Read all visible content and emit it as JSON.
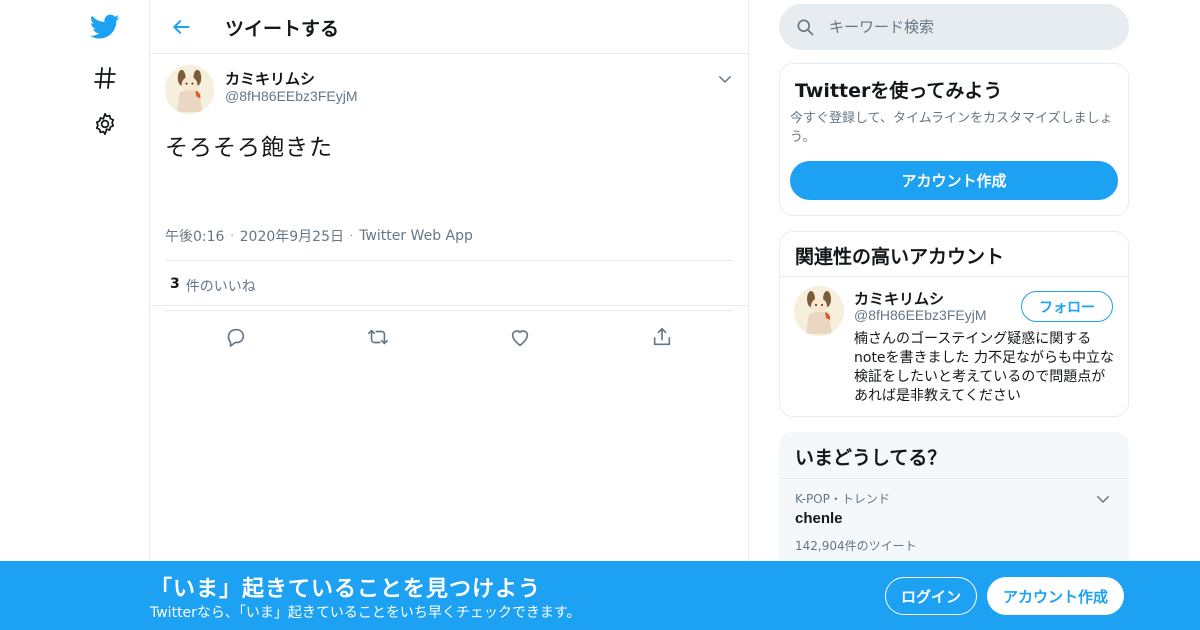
{
  "colors": {
    "accent": "#1da1f2",
    "muted": "#657786",
    "border": "#e6ecf0",
    "text": "#14171a"
  },
  "nav": {
    "icons": [
      "twitter-bird-icon",
      "hashtag-icon",
      "gear-icon"
    ]
  },
  "main": {
    "header_title": "ツイートする",
    "tweet": {
      "author_name": "カミキリムシ",
      "author_handle": "@8fH86EEbz3FEyjM",
      "text": "そろそろ飽きた",
      "time": "午後0:16",
      "date": "2020年9月25日",
      "source": "Twitter Web App",
      "likes_count": "3",
      "likes_label": "件のいいね"
    }
  },
  "sidebar": {
    "search_placeholder": "キーワード検索",
    "signup_card": {
      "title": "Twitterを使ってみよう",
      "description": "今すぐ登録して、タイムラインをカスタマイズしましょう。",
      "button": "アカウント作成"
    },
    "related_card": {
      "title": "関連性の高いアカウント",
      "name": "カミキリムシ",
      "handle": "@8fH86EEbz3FEyjM",
      "follow": "フォロー",
      "bio": "楠さんのゴーステイング疑惑に関するnoteを書きました 力不足ながらも中立な検証をしたいと考えているので問題点があれば是非教えてください"
    },
    "trends_card": {
      "title": "いまどうしてる？",
      "category": "K-POP・トレンド",
      "trend": "chenle",
      "tweet_count": "142,904件のツイート"
    }
  },
  "banner": {
    "title": "「いま」起きていることを見つけよう",
    "subtitle": "Twitterなら、「いま」起きていることをいち早くチェックできます。",
    "login": "ログイン",
    "signup": "アカウント作成"
  }
}
